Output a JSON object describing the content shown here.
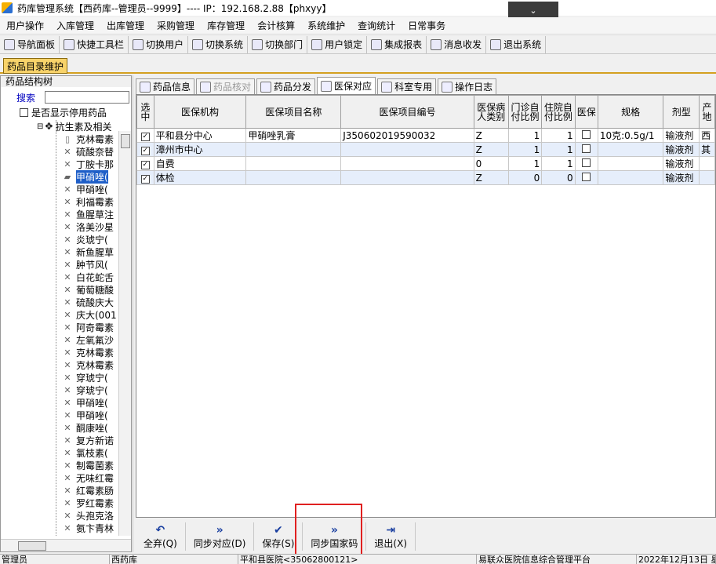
{
  "window": {
    "title": "药库管理系统【西药库--管理员--9999】---- IP：192.168.2.88【phxyy】",
    "dropdown_icon": "chevron-down-icon"
  },
  "menu": [
    "用户操作",
    "入库管理",
    "出库管理",
    "采购管理",
    "库存管理",
    "会计核算",
    "系统维护",
    "查询统计",
    "日常事务"
  ],
  "toolbar": [
    "导航面板",
    "快捷工具栏",
    "切换用户",
    "切换系统",
    "切换部门",
    "用户锁定",
    "集成报表",
    "消息收发",
    "退出系统"
  ],
  "doc_tab": "药品目录维护",
  "left": {
    "title": "药品结构树",
    "search_label": "搜索",
    "search_value": "",
    "show_disabled_label": "是否显示停用药品",
    "tree_root": "抗生素及相关",
    "tree_items": [
      "克林霉素",
      "硫酸奈替",
      "丁胺卡那",
      "甲硝唑(",
      "甲硝唑(",
      "利福霉素",
      "鱼腥草注",
      "洛美沙星",
      "炎琥宁(",
      "新鱼腥草",
      "肿节风(",
      "白花蛇舌",
      "葡萄糖酸",
      "硫酸庆大",
      "庆大(001",
      "阿奇霉素",
      "左氧氟沙",
      "克林霉素",
      "克林霉素",
      "穿琥宁(",
      "穿琥宁(",
      "甲硝唑(",
      "甲硝唑(",
      "酮康唑(",
      "复方新诺",
      "氯枝素(",
      "制霉菌素",
      "无味红霉",
      "红霉素肠",
      "罗红霉素",
      "头孢克洛",
      "氨卞青林"
    ],
    "selected_index": 3
  },
  "tabs": [
    {
      "label": "药品信息",
      "state": "normal"
    },
    {
      "label": "药品核对",
      "state": "disabled"
    },
    {
      "label": "药品分发",
      "state": "normal"
    },
    {
      "label": "医保对应",
      "state": "active"
    },
    {
      "label": "科室专用",
      "state": "normal"
    },
    {
      "label": "操作日志",
      "state": "normal"
    }
  ],
  "grid": {
    "columns": [
      "选中",
      "医保机构",
      "医保项目名称",
      "医保项目编号",
      "医保病人类别",
      "门诊自付比例",
      "住院自付比例",
      "医保",
      "规格",
      "剂型",
      "产地"
    ],
    "rows": [
      {
        "checked": true,
        "org": "平和县分中心",
        "name": "甲硝唑乳膏",
        "code": "J35060201959​0032",
        "cat": "Z",
        "op": "1",
        "ip": "1",
        "yb": false,
        "spec": "10克:0.5g/1",
        "form": "输液剂",
        "origin": "西"
      },
      {
        "checked": true,
        "org": "漳州市中心",
        "name": "",
        "code": "",
        "cat": "Z",
        "op": "1",
        "ip": "1",
        "yb": false,
        "spec": "",
        "form": "输液剂",
        "origin": "其"
      },
      {
        "checked": true,
        "org": "自费",
        "name": "",
        "code": "",
        "cat": "0",
        "op": "1",
        "ip": "1",
        "yb": false,
        "spec": "",
        "form": "输液剂",
        "origin": ""
      },
      {
        "checked": true,
        "org": "体检",
        "name": "",
        "code": "",
        "cat": "Z",
        "op": "0",
        "ip": "0",
        "yb": false,
        "spec": "",
        "form": "输液剂",
        "origin": ""
      }
    ]
  },
  "buttons": [
    {
      "label": "全弃(Q)",
      "icon": "undo-icon"
    },
    {
      "label": "同步对应(D)",
      "icon": "double-chevron-right-icon"
    },
    {
      "label": "保存(S)",
      "icon": "check-icon"
    },
    {
      "label": "同步国家码",
      "icon": "double-chevron-right-icon"
    },
    {
      "label": "退出(X)",
      "icon": "exit-icon"
    }
  ],
  "status": [
    "管理员",
    "西药库",
    "平和县医院<35062800121>",
    "易联众医院信息综合管理平台",
    "2022年12月13日 星"
  ]
}
